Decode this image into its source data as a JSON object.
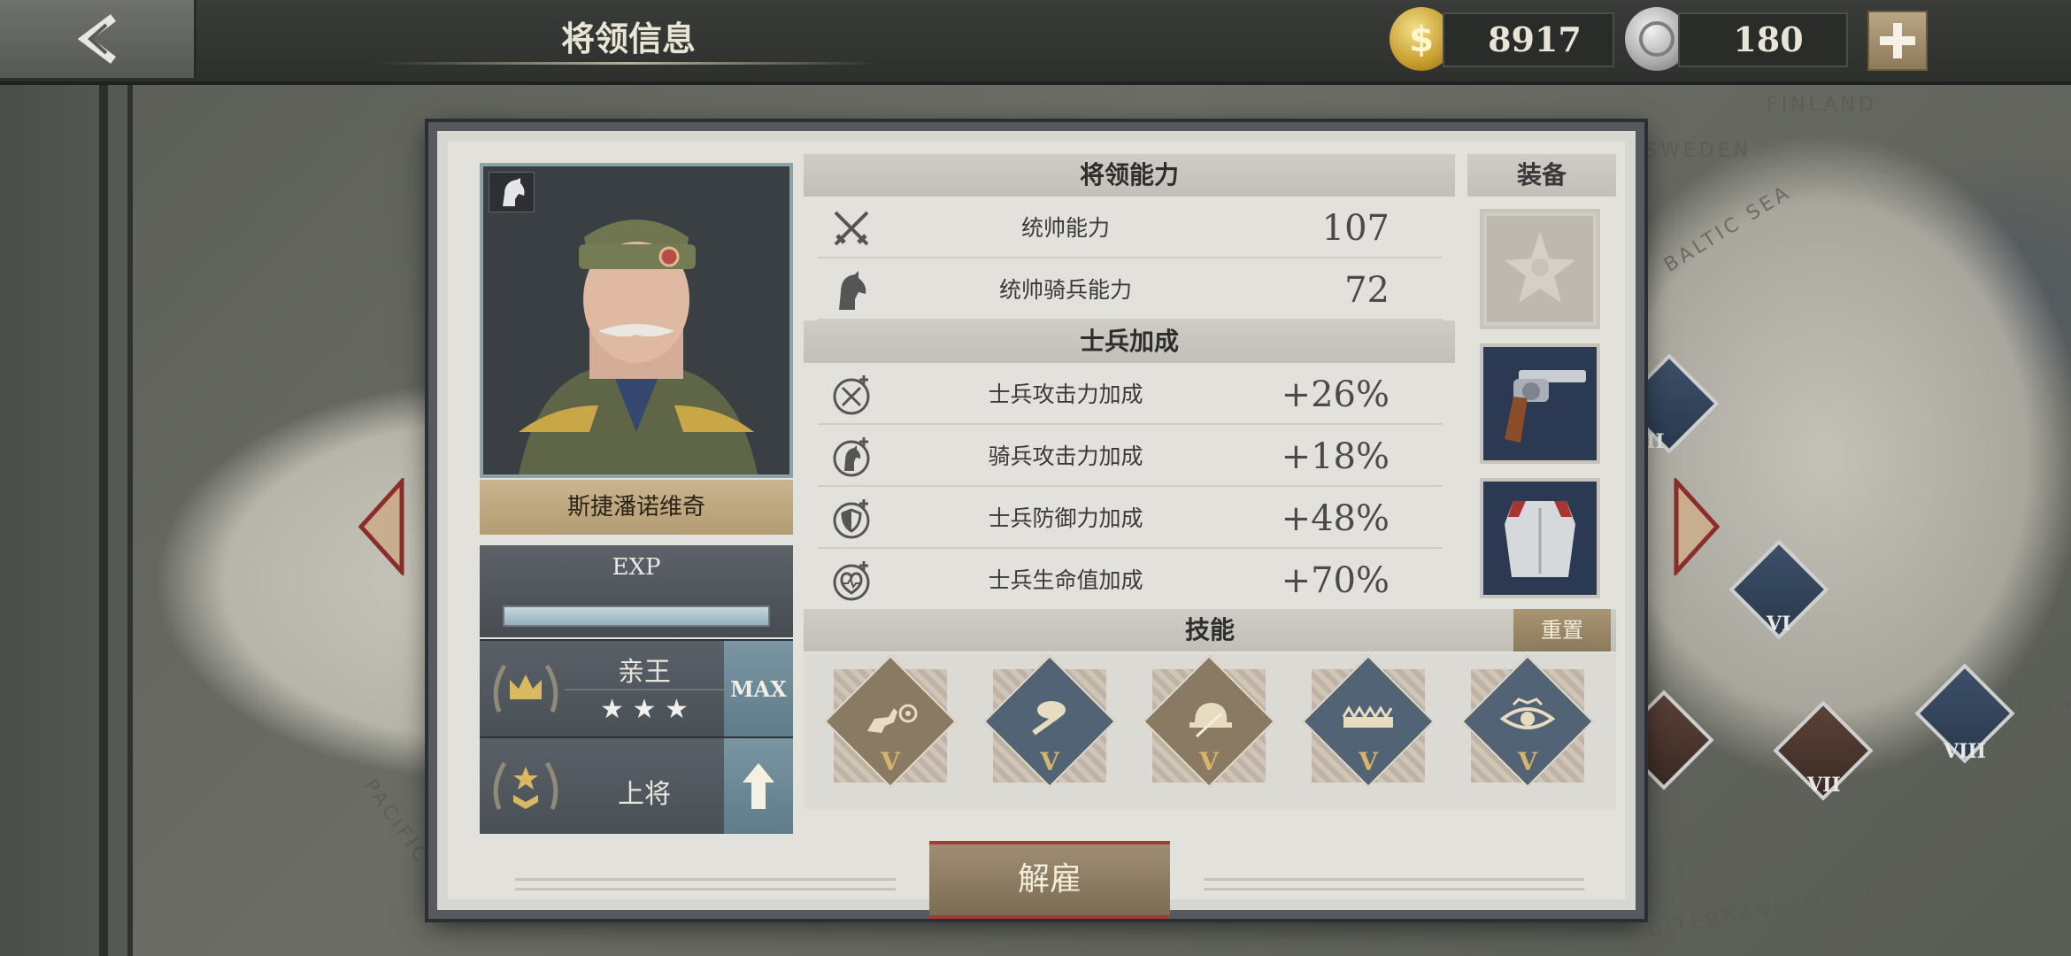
{
  "topbar": {
    "title": "将领信息",
    "gold": "8917",
    "medals": "180"
  },
  "map": {
    "labels": [
      "FINLAND",
      "SWEDEN",
      "BALTIC SEA",
      "PACIFIC",
      "DITERRANEAN SEA",
      "LACK"
    ],
    "units": [
      "II",
      "VI",
      "VII",
      "VIII"
    ]
  },
  "general": {
    "name": "斯捷潘诺维奇",
    "exp_label": "EXP",
    "exp_progress": 1.0,
    "title_rank": "亲王",
    "title_stars": "★ ★ ★",
    "title_status": "MAX",
    "military_rank": "上将"
  },
  "abilities": {
    "header": "将领能力",
    "items": [
      {
        "icon": "crossed-swords-icon",
        "name": "统帅能力",
        "value": "107"
      },
      {
        "icon": "horse-head-icon",
        "name": "统帅骑兵能力",
        "value": "72"
      }
    ]
  },
  "bonus": {
    "header": "士兵加成",
    "items": [
      {
        "icon": "sword-plus-icon",
        "name": "士兵攻击力加成",
        "value": "+26%"
      },
      {
        "icon": "horse-plus-icon",
        "name": "骑兵攻击力加成",
        "value": "+18%"
      },
      {
        "icon": "shield-plus-icon",
        "name": "士兵防御力加成",
        "value": "+48%"
      },
      {
        "icon": "heart-plus-icon",
        "name": "士兵生命值加成",
        "value": "+70%"
      }
    ]
  },
  "equipment": {
    "header": "装备",
    "slots": [
      "medal-icon",
      "revolver-icon",
      "cuirass-icon"
    ]
  },
  "skills": {
    "header": "技能",
    "reset_label": "重置",
    "items": [
      {
        "icon": "cavalry-target-icon",
        "level": "V"
      },
      {
        "icon": "bread-wrench-icon",
        "level": "V"
      },
      {
        "icon": "helmet-knife-icon",
        "level": "V"
      },
      {
        "icon": "barbed-wire-icon",
        "level": "V"
      },
      {
        "icon": "eye-icon",
        "level": "V"
      }
    ]
  },
  "dismiss_label": "解雇",
  "colors": {
    "gold_accent": "#b29c74",
    "exp_bar": "#93aebb",
    "dismiss_border": "#a23a35",
    "skill_level": "#d6b56b"
  }
}
